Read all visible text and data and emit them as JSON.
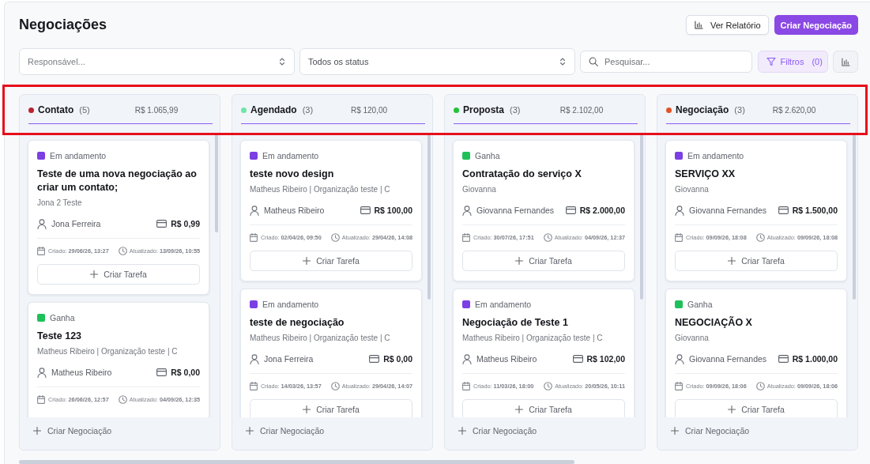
{
  "page": {
    "title": "Negociações"
  },
  "report_button": {
    "label": "Ver Relatório"
  },
  "create_button": {
    "label": "Criar Negociação"
  },
  "filters": {
    "responsible": {
      "placeholder": "Responsável..."
    },
    "status": {
      "value": "Todos os status"
    },
    "search": {
      "placeholder": "Pesquisar..."
    },
    "filters_button": {
      "label": "Filtros",
      "count": "(0)"
    }
  },
  "highlight": {
    "column_headers": true
  },
  "columns": [
    {
      "name": "Contato",
      "count": "(5)",
      "total": "R$ 1.065,99",
      "color": "#b8232f",
      "add_label": "Criar Negociação",
      "cards": [
        {
          "status": {
            "label": "Em andamento",
            "color": "#7c3fe4"
          },
          "title": "Teste de uma nova negociação ao criar um contato;",
          "subtitle": "Jona 2 Teste",
          "owner": "Jona Ferreira",
          "amount": "R$ 0,99",
          "created": "Criado: **29/06/26, 13:27**",
          "updated": "Atualizado: **13/09/26, 10:55**",
          "task_button": "Criar Tarefa"
        },
        {
          "status": {
            "label": "Ganha",
            "color": "#1ec05a"
          },
          "title": "Teste 123",
          "subtitle": "Matheus Ribeiro | Organização teste | C",
          "owner": "Matheus Ribeiro",
          "amount": "R$ 0,00",
          "created": "Criado: **26/06/26, 12:57**",
          "updated": "Atualizado: **04/09/26, 12:35**"
        }
      ]
    },
    {
      "name": "Agendado",
      "count": "(3)",
      "total": "R$ 120,00",
      "color": "#6ee7a6",
      "add_label": "Criar Negociação",
      "cards": [
        {
          "status": {
            "label": "Em andamento",
            "color": "#7c3fe4"
          },
          "title": "teste novo design",
          "subtitle": "Matheus Ribeiro | Organização teste | C",
          "owner": "Matheus Ribeiro",
          "amount": "R$ 100,00",
          "created": "Criado: **02/04/26, 09:50**",
          "updated": "Atualizado: **29/04/26, 14:08**",
          "task_button": "Criar Tarefa"
        },
        {
          "status": {
            "label": "Em andamento",
            "color": "#7c3fe4"
          },
          "title": "teste de negociação",
          "subtitle": "Matheus Ribeiro | Organização teste | C",
          "owner": "Jona Ferreira",
          "amount": "R$ 0,00",
          "created": "Criado: **14/03/26, 13:57**",
          "updated": "Atualizado: **29/04/26, 14:07**",
          "task_button": "Criar Tarefa"
        }
      ]
    },
    {
      "name": "Proposta",
      "count": "(3)",
      "total": "R$ 2.102,00",
      "color": "#22c33a",
      "add_label": "Criar Negociação",
      "cards": [
        {
          "status": {
            "label": "Ganha",
            "color": "#1ec05a"
          },
          "title": "Contratação do serviço X",
          "subtitle": "Giovanna",
          "owner": "Giovanna Fernandes",
          "amount": "R$ 2.000,00",
          "created": "Criado: **30/07/26, 17:51**",
          "updated": "Atualizado: **04/09/26, 12:37**",
          "task_button": "Criar Tarefa"
        },
        {
          "status": {
            "label": "Em andamento",
            "color": "#7c3fe4"
          },
          "title": "Negociação de Teste 1",
          "subtitle": "Matheus Ribeiro | Organização teste | C",
          "owner": "Matheus Ribeiro",
          "amount": "R$ 102,00",
          "created": "Criado: **11/03/26, 18:00**",
          "updated": "Atualizado: **20/05/26, 10:11**",
          "task_button": "Criar Tarefa"
        }
      ]
    },
    {
      "name": "Negociação",
      "count": "(3)",
      "total": "R$ 2.620,00",
      "color": "#e0542a",
      "add_label": "Criar Negociação",
      "cards": [
        {
          "status": {
            "label": "Em andamento",
            "color": "#7c3fe4"
          },
          "title": "SERVIÇO XX",
          "subtitle": "Giovanna",
          "owner": "Giovanna Fernandes",
          "amount": "R$ 1.500,00",
          "created": "Criado: **09/09/26, 18:08**",
          "updated": "Atualizado: **09/09/26, 18:08**",
          "task_button": "Criar Tarefa"
        },
        {
          "status": {
            "label": "Ganha",
            "color": "#1ec05a"
          },
          "title": "NEGOCIAÇÃO X",
          "subtitle": "Giovanna",
          "owner": "Giovanna Fernandes",
          "amount": "R$ 1.000,00",
          "created": "Criado: **09/09/26, 18:06**",
          "updated": "Atualizado: **09/09/26, 18:06**",
          "task_button": "Criar Tarefa"
        }
      ]
    }
  ]
}
